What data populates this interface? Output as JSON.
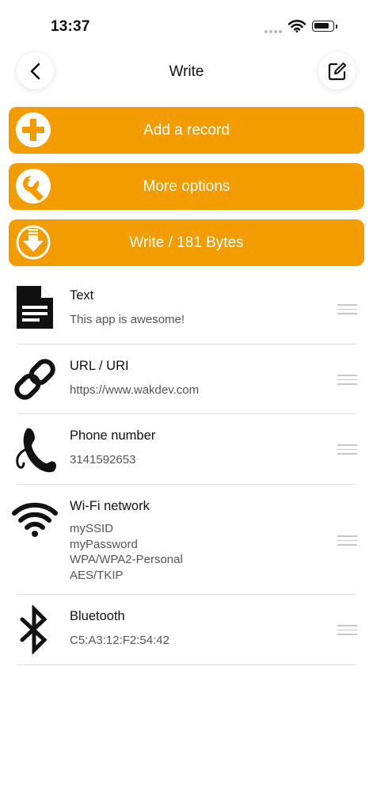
{
  "status_bar": {
    "time": "13:37",
    "battery_level": 0.85
  },
  "nav": {
    "title": "Write",
    "back_icon": "chevron-left-icon",
    "edit_icon": "edit-note-icon"
  },
  "actions": [
    {
      "label": "Add a record",
      "icon": "plus-circle-icon"
    },
    {
      "label": "More options",
      "icon": "wrench-circle-icon"
    },
    {
      "label": "Write / 181 Bytes",
      "icon": "download-circle-icon"
    }
  ],
  "records": [
    {
      "title": "Text",
      "lines": [
        "This app is awesome!"
      ],
      "icon": "document-icon"
    },
    {
      "title": "URL / URI",
      "lines": [
        "https://www.wakdev.com"
      ],
      "icon": "link-icon"
    },
    {
      "title": "Phone number",
      "lines": [
        "3141592653"
      ],
      "icon": "phone-icon"
    },
    {
      "title": "Wi-Fi network",
      "lines": [
        "mySSID",
        "myPassword",
        "WPA/WPA2-Personal",
        "AES/TKIP"
      ],
      "icon": "wifi-icon"
    },
    {
      "title": "Bluetooth",
      "lines": [
        "C5:A3:12:F2:54:42"
      ],
      "icon": "bluetooth-icon"
    }
  ],
  "colors": {
    "accent": "#f39c00",
    "text": "#111111",
    "subtext": "#555555",
    "divider": "#dedede"
  }
}
